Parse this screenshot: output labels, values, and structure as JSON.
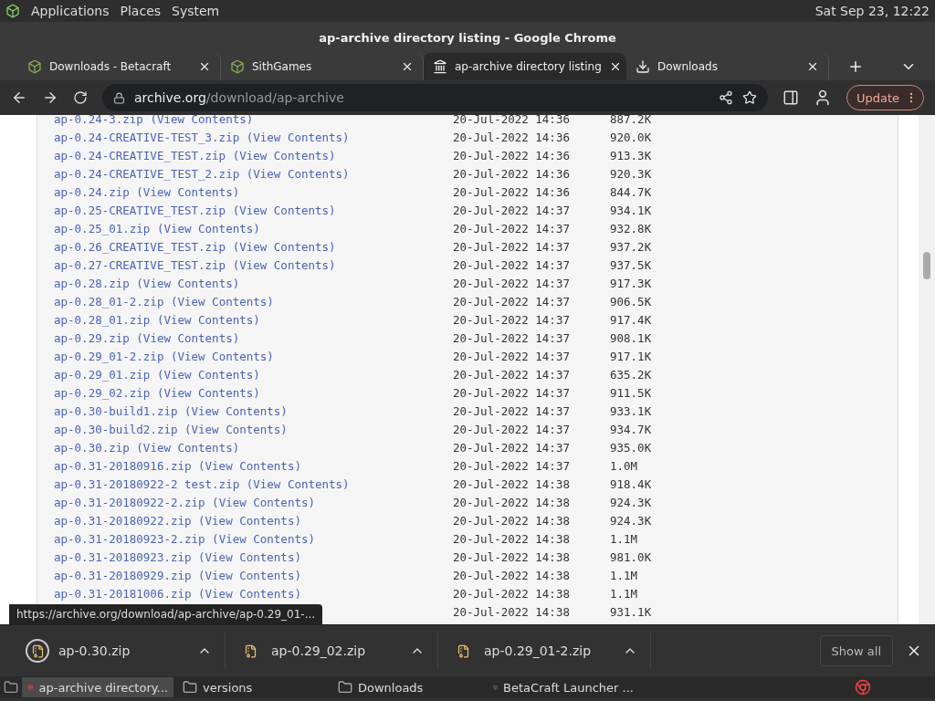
{
  "top_panel": {
    "menus": [
      "Applications",
      "Places",
      "System"
    ],
    "clock": "Sat Sep 23, 12:22"
  },
  "window": {
    "title": "ap-archive directory listing - Google Chrome"
  },
  "tabs": [
    {
      "label": "Downloads - Betacraft",
      "kind": "site",
      "selected": false
    },
    {
      "label": "SithGames",
      "kind": "site",
      "selected": false
    },
    {
      "label": "ap-archive directory listing",
      "kind": "archive",
      "selected": true
    },
    {
      "label": "Downloads",
      "kind": "download",
      "selected": false
    }
  ],
  "address_bar": {
    "host": "archive.org",
    "path": "/download/ap-archive"
  },
  "update_button": "Update",
  "listing": {
    "rows": [
      {
        "file": "ap-0.24-3.zip",
        "view": "(View Contents)",
        "date": "20-Jul-2022 14:36",
        "size": "887.2K"
      },
      {
        "file": "ap-0.24-CREATIVE-TEST_3.zip",
        "view": "(View Contents)",
        "date": "20-Jul-2022 14:36",
        "size": "920.0K"
      },
      {
        "file": "ap-0.24-CREATIVE_TEST.zip",
        "view": "(View Contents)",
        "date": "20-Jul-2022 14:36",
        "size": "913.3K"
      },
      {
        "file": "ap-0.24-CREATIVE_TEST_2.zip",
        "view": "(View Contents)",
        "date": "20-Jul-2022 14:36",
        "size": "920.3K"
      },
      {
        "file": "ap-0.24.zip",
        "view": "(View Contents)",
        "date": "20-Jul-2022 14:36",
        "size": "844.7K"
      },
      {
        "file": "ap-0.25-CREATIVE_TEST.zip",
        "view": "(View Contents)",
        "date": "20-Jul-2022 14:37",
        "size": "934.1K"
      },
      {
        "file": "ap-0.25_01.zip",
        "view": "(View Contents)",
        "date": "20-Jul-2022 14:37",
        "size": "932.8K"
      },
      {
        "file": "ap-0.26_CREATIVE_TEST.zip",
        "view": "(View Contents)",
        "date": "20-Jul-2022 14:37",
        "size": "937.2K"
      },
      {
        "file": "ap-0.27-CREATIVE_TEST.zip",
        "view": "(View Contents)",
        "date": "20-Jul-2022 14:37",
        "size": "937.5K"
      },
      {
        "file": "ap-0.28.zip",
        "view": "(View Contents)",
        "date": "20-Jul-2022 14:37",
        "size": "917.3K"
      },
      {
        "file": "ap-0.28_01-2.zip",
        "view": "(View Contents)",
        "date": "20-Jul-2022 14:37",
        "size": "906.5K"
      },
      {
        "file": "ap-0.28_01.zip",
        "view": "(View Contents)",
        "date": "20-Jul-2022 14:37",
        "size": "917.4K"
      },
      {
        "file": "ap-0.29.zip",
        "view": "(View Contents)",
        "date": "20-Jul-2022 14:37",
        "size": "908.1K"
      },
      {
        "file": "ap-0.29_01-2.zip",
        "view": "(View Contents)",
        "date": "20-Jul-2022 14:37",
        "size": "917.1K"
      },
      {
        "file": "ap-0.29_01.zip",
        "view": "(View Contents)",
        "date": "20-Jul-2022 14:37",
        "size": "635.2K"
      },
      {
        "file": "ap-0.29_02.zip",
        "view": "(View Contents)",
        "date": "20-Jul-2022 14:37",
        "size": "911.5K"
      },
      {
        "file": "ap-0.30-build1.zip",
        "view": "(View Contents)",
        "date": "20-Jul-2022 14:37",
        "size": "933.1K"
      },
      {
        "file": "ap-0.30-build2.zip",
        "view": "(View Contents)",
        "date": "20-Jul-2022 14:37",
        "size": "934.7K"
      },
      {
        "file": "ap-0.30.zip",
        "view": "(View Contents)",
        "date": "20-Jul-2022 14:37",
        "size": "935.0K"
      },
      {
        "file": "ap-0.31-20180916.zip",
        "view": "(View Contents)",
        "date": "20-Jul-2022 14:37",
        "size": "1.0M"
      },
      {
        "file": "ap-0.31-20180922-2 test.zip",
        "view": "(View Contents)",
        "date": "20-Jul-2022 14:38",
        "size": "918.4K"
      },
      {
        "file": "ap-0.31-20180922-2.zip",
        "view": "(View Contents)",
        "date": "20-Jul-2022 14:38",
        "size": "924.3K"
      },
      {
        "file": "ap-0.31-20180922.zip",
        "view": "(View Contents)",
        "date": "20-Jul-2022 14:38",
        "size": "924.3K"
      },
      {
        "file": "ap-0.31-20180923-2.zip",
        "view": "(View Contents)",
        "date": "20-Jul-2022 14:38",
        "size": "1.1M"
      },
      {
        "file": "ap-0.31-20180923.zip",
        "view": "(View Contents)",
        "date": "20-Jul-2022 14:38",
        "size": "981.0K"
      },
      {
        "file": "ap-0.31-20180929.zip",
        "view": "(View Contents)",
        "date": "20-Jul-2022 14:38",
        "size": "1.1M"
      },
      {
        "file": "ap-0.31-20181006.zip",
        "view": "(View Contents)",
        "date": "20-Jul-2022 14:38",
        "size": "1.1M"
      },
      {
        "date": "20-Jul-2022 14:38",
        "size": "931.1K"
      }
    ]
  },
  "status_url": "https://archive.org/download/ap-archive/ap-0.29_01-...",
  "downloads": [
    {
      "file": "ap-0.30.zip",
      "selected": true
    },
    {
      "file": "ap-0.29_02.zip",
      "selected": false
    },
    {
      "file": "ap-0.29_01-2.zip",
      "selected": false
    }
  ],
  "show_all": "Show all",
  "taskbar": [
    {
      "label": "ap-archive directory...",
      "kind": "browser",
      "selected": true
    },
    {
      "label": "versions",
      "kind": "folder",
      "selected": false
    },
    {
      "label": "Downloads",
      "kind": "folder",
      "selected": false
    },
    {
      "label": "BetaCraft Launcher ...",
      "kind": "app",
      "selected": false
    }
  ]
}
